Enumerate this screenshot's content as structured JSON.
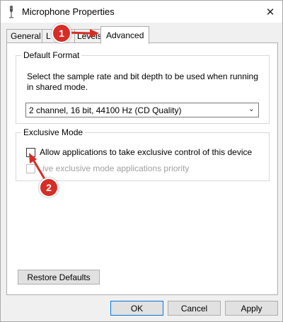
{
  "window": {
    "title": "Microphone Properties",
    "close_glyph": "✕"
  },
  "tabs": [
    {
      "label": "General",
      "active": false
    },
    {
      "label": "L",
      "active": false
    },
    {
      "label": "Levels",
      "active": false
    },
    {
      "label": "Advanced",
      "active": true
    }
  ],
  "default_format": {
    "group_label": "Default Format",
    "description": "Select the sample rate and bit depth to be used when running in shared mode.",
    "selected": "2 channel, 16 bit, 44100 Hz (CD Quality)"
  },
  "exclusive_mode": {
    "group_label": "Exclusive Mode",
    "allow_label": "Allow applications to take exclusive control of this device",
    "allow_checked": false,
    "priority_label": "ive exclusive mode applications priority",
    "priority_checked": false,
    "priority_enabled": false
  },
  "restore_label": "Restore Defaults",
  "buttons": {
    "ok": "OK",
    "cancel": "Cancel",
    "apply": "Apply"
  },
  "annotations": {
    "badge1": "1",
    "badge2": "2",
    "color": "#d62d26"
  }
}
